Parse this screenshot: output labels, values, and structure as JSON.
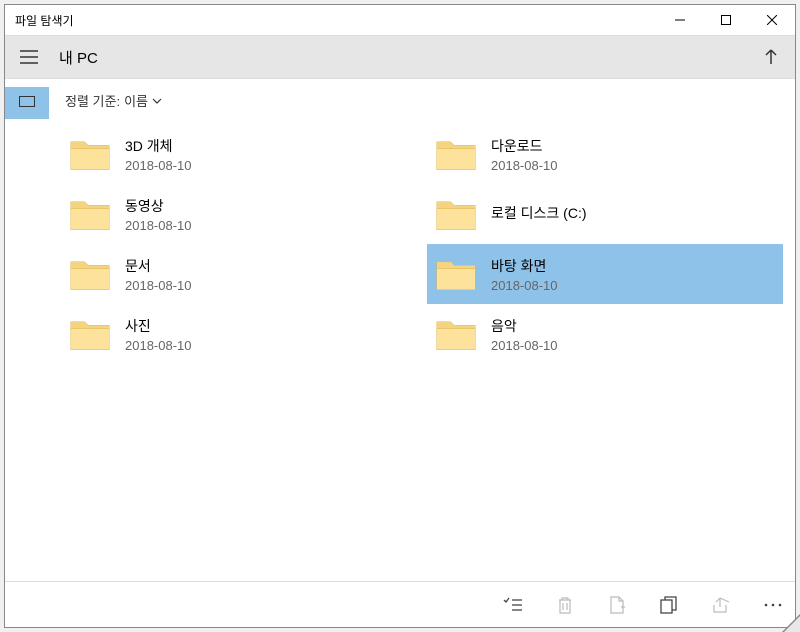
{
  "titlebar": {
    "title": "파일 탐색기"
  },
  "location": {
    "path": "내 PC"
  },
  "sort": {
    "label_prefix": "정렬 기준:",
    "value": "이름"
  },
  "folders": [
    {
      "name": "3D 개체",
      "date": "2018-08-10",
      "selected": false
    },
    {
      "name": "다운로드",
      "date": "2018-08-10",
      "selected": false
    },
    {
      "name": "동영상",
      "date": "2018-08-10",
      "selected": false
    },
    {
      "name": "로컬 디스크 (C:)",
      "date": "",
      "selected": false
    },
    {
      "name": "문서",
      "date": "2018-08-10",
      "selected": false
    },
    {
      "name": "바탕 화면",
      "date": "2018-08-10",
      "selected": true
    },
    {
      "name": "사진",
      "date": "2018-08-10",
      "selected": false
    },
    {
      "name": "음악",
      "date": "2018-08-10",
      "selected": false
    }
  ],
  "toolbar": {
    "select_all": "select-all",
    "delete": "delete",
    "new_folder": "new-folder",
    "copy": "copy",
    "share": "share",
    "more": "more"
  }
}
